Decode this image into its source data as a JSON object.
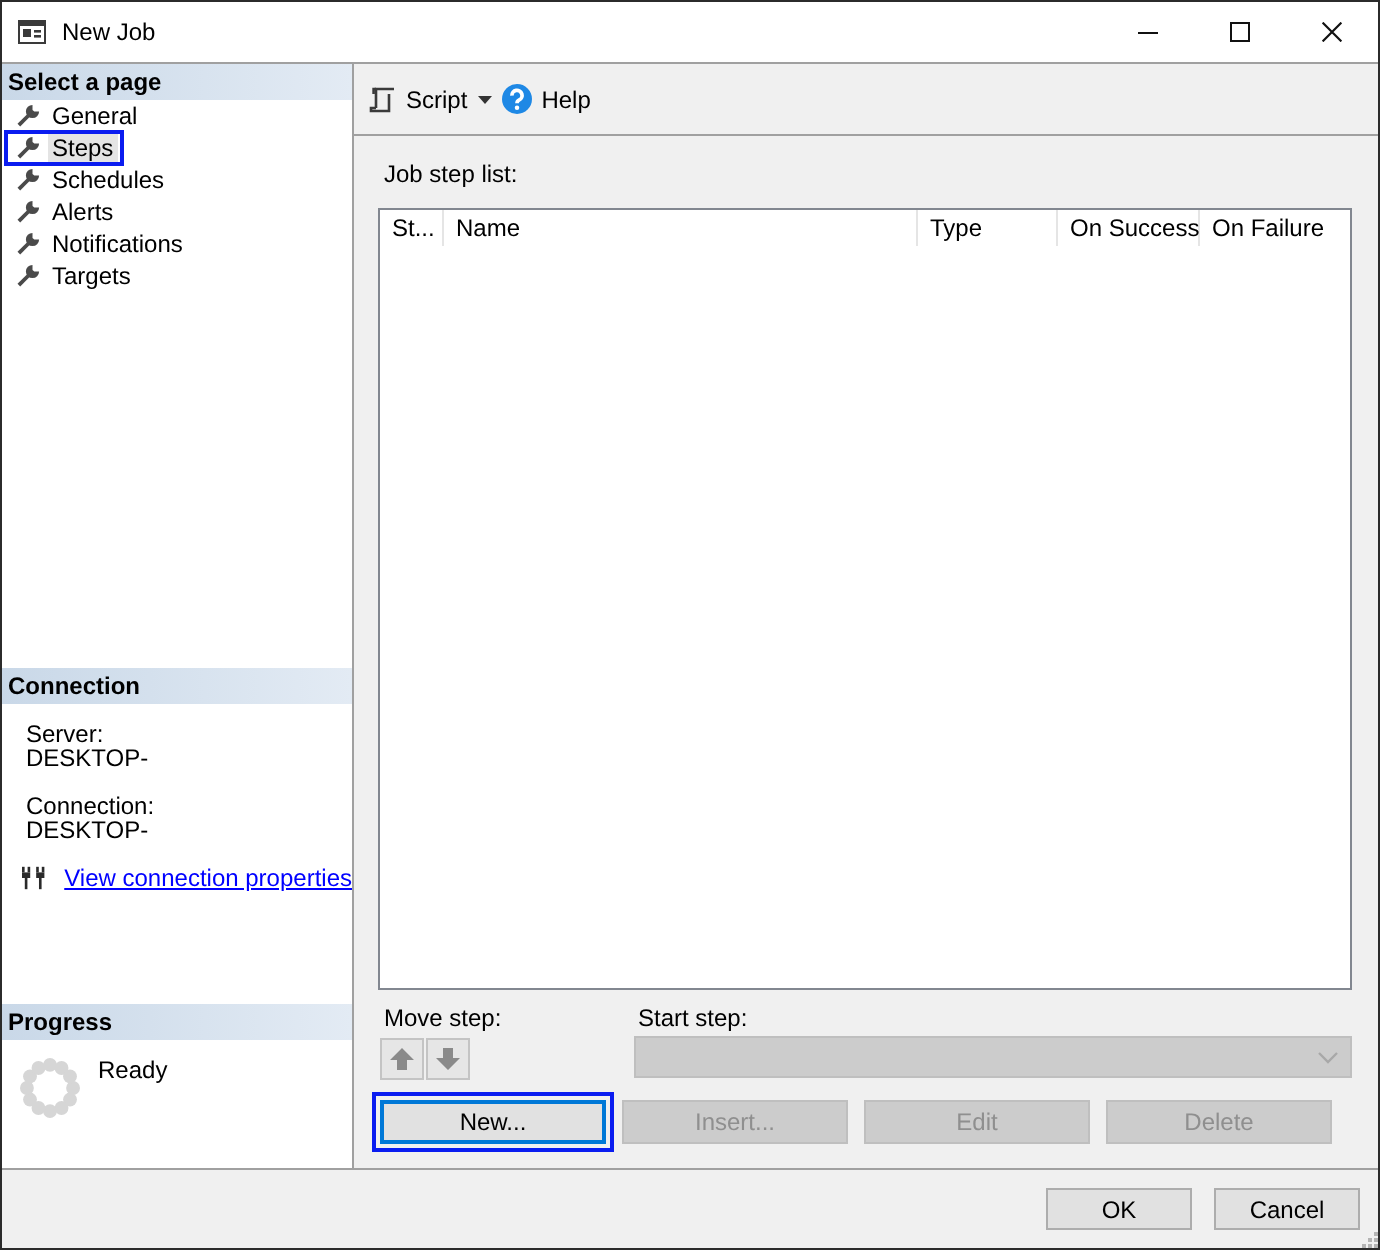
{
  "window": {
    "title": "New Job",
    "controls": [
      {
        "kind": "minimize"
      },
      {
        "kind": "maximize"
      },
      {
        "kind": "close"
      }
    ]
  },
  "select_page": {
    "heading": "Select a page",
    "items": [
      {
        "label": "General",
        "selected": false,
        "highlighted": false
      },
      {
        "label": "Steps",
        "selected": true,
        "highlighted": true
      },
      {
        "label": "Schedules",
        "selected": false,
        "highlighted": false
      },
      {
        "label": "Alerts",
        "selected": false,
        "highlighted": false
      },
      {
        "label": "Notifications",
        "selected": false,
        "highlighted": false
      },
      {
        "label": "Targets",
        "selected": false,
        "highlighted": false
      }
    ]
  },
  "connection": {
    "heading": "Connection",
    "fields": [
      {
        "label": "Server:",
        "value": "DESKTOP-"
      },
      {
        "label": "Connection:",
        "value": "DESKTOP-"
      }
    ],
    "link": "View connection properties"
  },
  "progress": {
    "heading": "Progress",
    "status": "Ready"
  },
  "toolbar": {
    "items": [
      {
        "kind": "script",
        "label": "Script"
      },
      {
        "kind": "help",
        "label": "Help"
      }
    ]
  },
  "job_step_list": {
    "label": "Job step list:",
    "columns": [
      "St...",
      "Name",
      "Type",
      "On Success",
      "On Failure"
    ]
  },
  "move_step": {
    "label": "Move step:",
    "buttons": [
      {
        "kind": "up"
      },
      {
        "kind": "down"
      }
    ]
  },
  "start_step": {
    "label": "Start step:",
    "disabled": true
  },
  "step_buttons": [
    {
      "label": "New...",
      "disabled": false,
      "focused": true,
      "highlighted": true
    },
    {
      "label": "Insert...",
      "disabled": true,
      "focused": false,
      "highlighted": false
    },
    {
      "label": "Edit",
      "disabled": true,
      "focused": false,
      "highlighted": false
    },
    {
      "label": "Delete",
      "disabled": true,
      "focused": false,
      "highlighted": false
    }
  ],
  "dialog_buttons": [
    {
      "label": "OK"
    },
    {
      "label": "Cancel"
    }
  ]
}
